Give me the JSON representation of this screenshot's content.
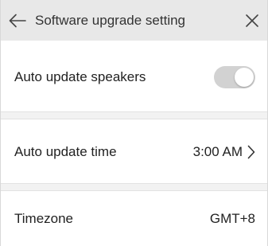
{
  "header": {
    "title": "Software upgrade setting",
    "back_icon": "arrow-left-icon",
    "close_icon": "close-icon"
  },
  "settings": {
    "auto_update_speakers": {
      "label": "Auto update speakers",
      "toggle_state": "on-disabled"
    },
    "auto_update_time": {
      "label": "Auto update time",
      "value": "3:00 AM",
      "icon": "chevron-right-icon"
    },
    "timezone": {
      "label": "Timezone",
      "value": "GMT+8"
    }
  },
  "colors": {
    "header_bg": "#e8e8e8",
    "toggle_track": "#d2d2d2",
    "text": "#222222"
  }
}
